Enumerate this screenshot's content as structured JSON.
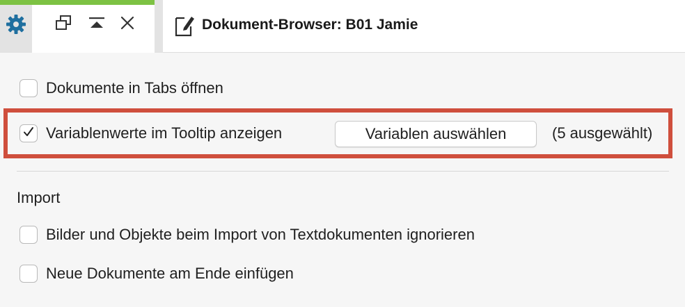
{
  "colors": {
    "accent_green": "#7dc243",
    "gear_blue": "#1f6f9f",
    "highlight_red": "#cf4f3d"
  },
  "toolbar": {
    "settings_icon": "gear-icon",
    "restore_icon": "restore-window-icon",
    "move_top_icon": "move-to-top-icon",
    "close_icon": "close-icon"
  },
  "header": {
    "icon": "edit-document-icon",
    "title": "Dokument-Browser: B01 Jamie"
  },
  "options": {
    "open_in_tabs": {
      "label": "Dokumente in Tabs öffnen",
      "checked": false
    },
    "tooltip_values": {
      "label": "Variablenwerte im Tooltip anzeigen",
      "checked": true,
      "button_label": "Variablen auswählen",
      "count_text": "(5 ausgewählt)"
    }
  },
  "import": {
    "title": "Import",
    "ignore_images": {
      "label": "Bilder und Objekte beim Import von Textdokumenten ignorieren",
      "checked": false
    },
    "append_end": {
      "label": "Neue Dokumente am Ende einfügen",
      "checked": false
    }
  }
}
